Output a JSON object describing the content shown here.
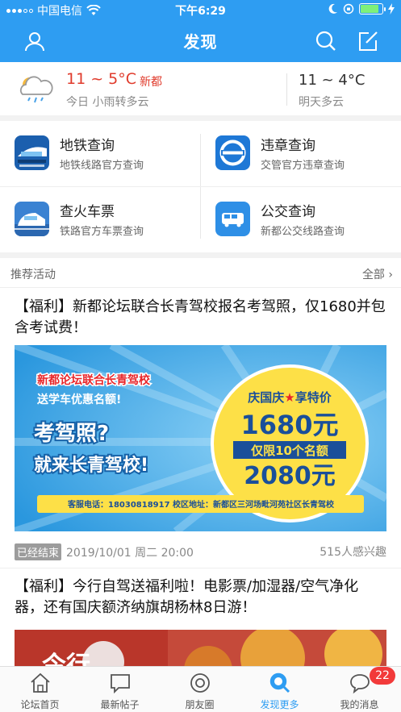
{
  "status_bar": {
    "carrier": "中国电信",
    "time": "下午6:29"
  },
  "header": {
    "title": "发现"
  },
  "weather": {
    "today_temp": "11 ~ 5°C",
    "city": "新都",
    "today_desc": "今日 小雨转多云",
    "tomorrow_temp": "11 ~ 4°C",
    "tomorrow_desc": "明天多云"
  },
  "services": [
    {
      "title": "地铁查询",
      "subtitle": "地铁线路官方查询",
      "icon": "metro-icon"
    },
    {
      "title": "违章查询",
      "subtitle": "交管官方违章查询",
      "icon": "traffic-violation-icon"
    },
    {
      "title": "查火车票",
      "subtitle": "铁路官方车票查询",
      "icon": "train-icon"
    },
    {
      "title": "公交查询",
      "subtitle": "新都公交线路查询",
      "icon": "bus-icon"
    }
  ],
  "recommend": {
    "heading": "推荐活动",
    "all_label": "全部",
    "posts": [
      {
        "title": "【福利】新都论坛联合长青驾校报名考驾照，仅1680并包含考试费！",
        "status": "已经结束",
        "date": "2019/10/01 周二 20:00",
        "interest": "515人感兴趣",
        "banner": {
          "line1": "新都论坛联合长青驾校",
          "line2": "送学车优惠名额!",
          "line3": "考驾照?",
          "line4": "就来长青驾校!",
          "circle_top": "庆国庆",
          "circle_top2": "享特价",
          "price_main": "1680元",
          "limit": "仅限10个名额",
          "price_orig": "2080元",
          "footer": "客服电话：18030818917  校区地址：新都区三河场毗河苑社区长青驾校"
        }
      },
      {
        "title": "【福利】今行自驾送福利啦！电影票/加湿器/空气净化器，还有国庆额济纳旗胡杨林8日游！",
        "banner_text": "今行"
      }
    ]
  },
  "tabbar": {
    "items": [
      {
        "label": "论坛首页"
      },
      {
        "label": "最新帖子"
      },
      {
        "label": "朋友圈"
      },
      {
        "label": "发现更多"
      },
      {
        "label": "我的消息"
      }
    ],
    "badge": "22"
  },
  "colors": {
    "brand": "#2e9df2",
    "accent_red": "#e03b2c",
    "badge": "#f23a3a"
  }
}
